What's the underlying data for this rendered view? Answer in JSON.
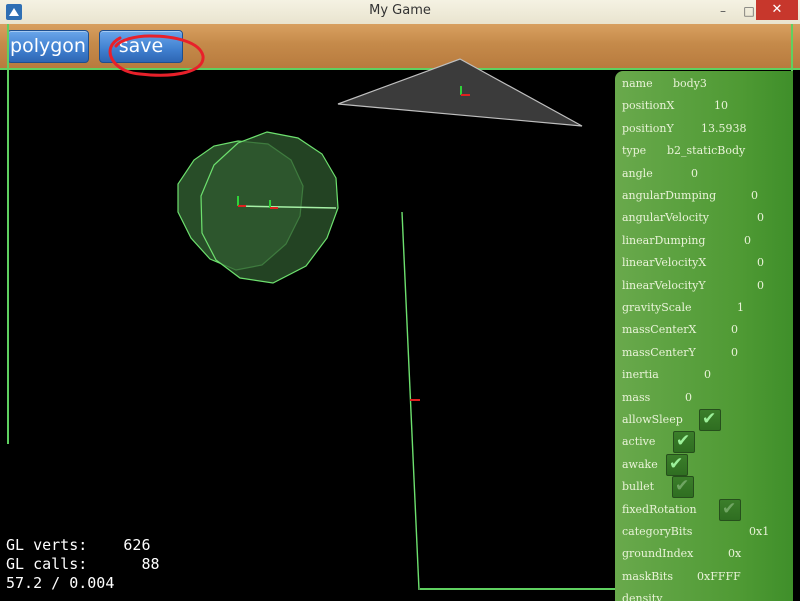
{
  "window": {
    "title": "My Game",
    "close_glyph": "✕",
    "minimize_glyph": "–",
    "maximize_glyph": "□"
  },
  "toolbar": {
    "polygon_label": "polygon",
    "save_label": "save"
  },
  "stats": {
    "gl_verts_label": "GL verts:",
    "gl_verts_value": "626",
    "gl_calls_label": "GL calls:",
    "gl_calls_value": "88",
    "fps_line": "57.2 / 0.004"
  },
  "panel": {
    "rows": [
      {
        "label": "name",
        "value": "body3"
      },
      {
        "label": "positionX",
        "value": "10"
      },
      {
        "label": "positionY",
        "value": "13.5938"
      },
      {
        "label": "type",
        "value": "b2_staticBody"
      },
      {
        "label": "angle",
        "value": "0"
      },
      {
        "label": "angularDumping",
        "value": "0"
      },
      {
        "label": "angularVelocity",
        "value": "0"
      },
      {
        "label": "linearDumping",
        "value": "0"
      },
      {
        "label": "linearVelocityX",
        "value": "0"
      },
      {
        "label": "linearVelocityY",
        "value": "0"
      },
      {
        "label": "gravityScale",
        "value": "1"
      },
      {
        "label": "massCenterX",
        "value": "0"
      },
      {
        "label": "massCenterY",
        "value": "0"
      },
      {
        "label": "inertia",
        "value": "0"
      },
      {
        "label": "mass",
        "value": "0"
      },
      {
        "label": "allowSleep",
        "checked": true
      },
      {
        "label": "active",
        "checked": true
      },
      {
        "label": "awake",
        "checked": true
      },
      {
        "label": "bullet",
        "checked": false
      },
      {
        "label": "fixedRotation",
        "checked": false
      },
      {
        "label": "categoryBits",
        "value": "0x1"
      },
      {
        "label": "groundIndex",
        "value": "0x"
      },
      {
        "label": "maskBits",
        "value": "0xFFFF"
      },
      {
        "label": "density",
        "value": ""
      }
    ]
  },
  "colors": {
    "accent": "#5fd060",
    "panel": "#4f9a34",
    "button": "#3f7fcf",
    "annotation": "#e8202a"
  }
}
